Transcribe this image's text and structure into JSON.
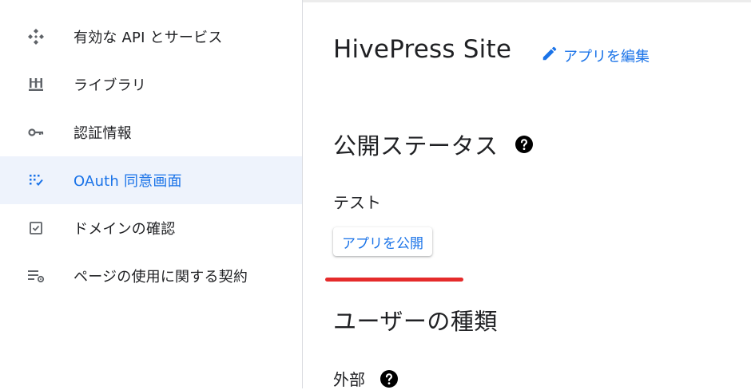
{
  "sidebar": {
    "items": [
      {
        "label": "有効な API とサービス",
        "icon": "api-diamond-icon",
        "active": false
      },
      {
        "label": "ライブラリ",
        "icon": "library-icon",
        "active": false
      },
      {
        "label": "認証情報",
        "icon": "key-icon",
        "active": false
      },
      {
        "label": "OAuth 同意画面",
        "icon": "oauth-consent-icon",
        "active": true
      },
      {
        "label": "ドメインの確認",
        "icon": "checkbox-icon",
        "active": false
      },
      {
        "label": "ページの使用に関する契約",
        "icon": "list-settings-icon",
        "active": false
      }
    ]
  },
  "main": {
    "app_title": "HivePress Site",
    "edit_link": "アプリを編集",
    "publish_status": {
      "heading": "公開ステータス",
      "value": "テスト",
      "publish_button": "アプリを公開"
    },
    "user_type": {
      "heading": "ユーザーの種類",
      "value": "外部"
    }
  },
  "colors": {
    "accent": "#1a73e8",
    "active_bg": "#eef3fc",
    "annotation_red": "#e52b2b",
    "icon_gray": "#5f6368"
  }
}
